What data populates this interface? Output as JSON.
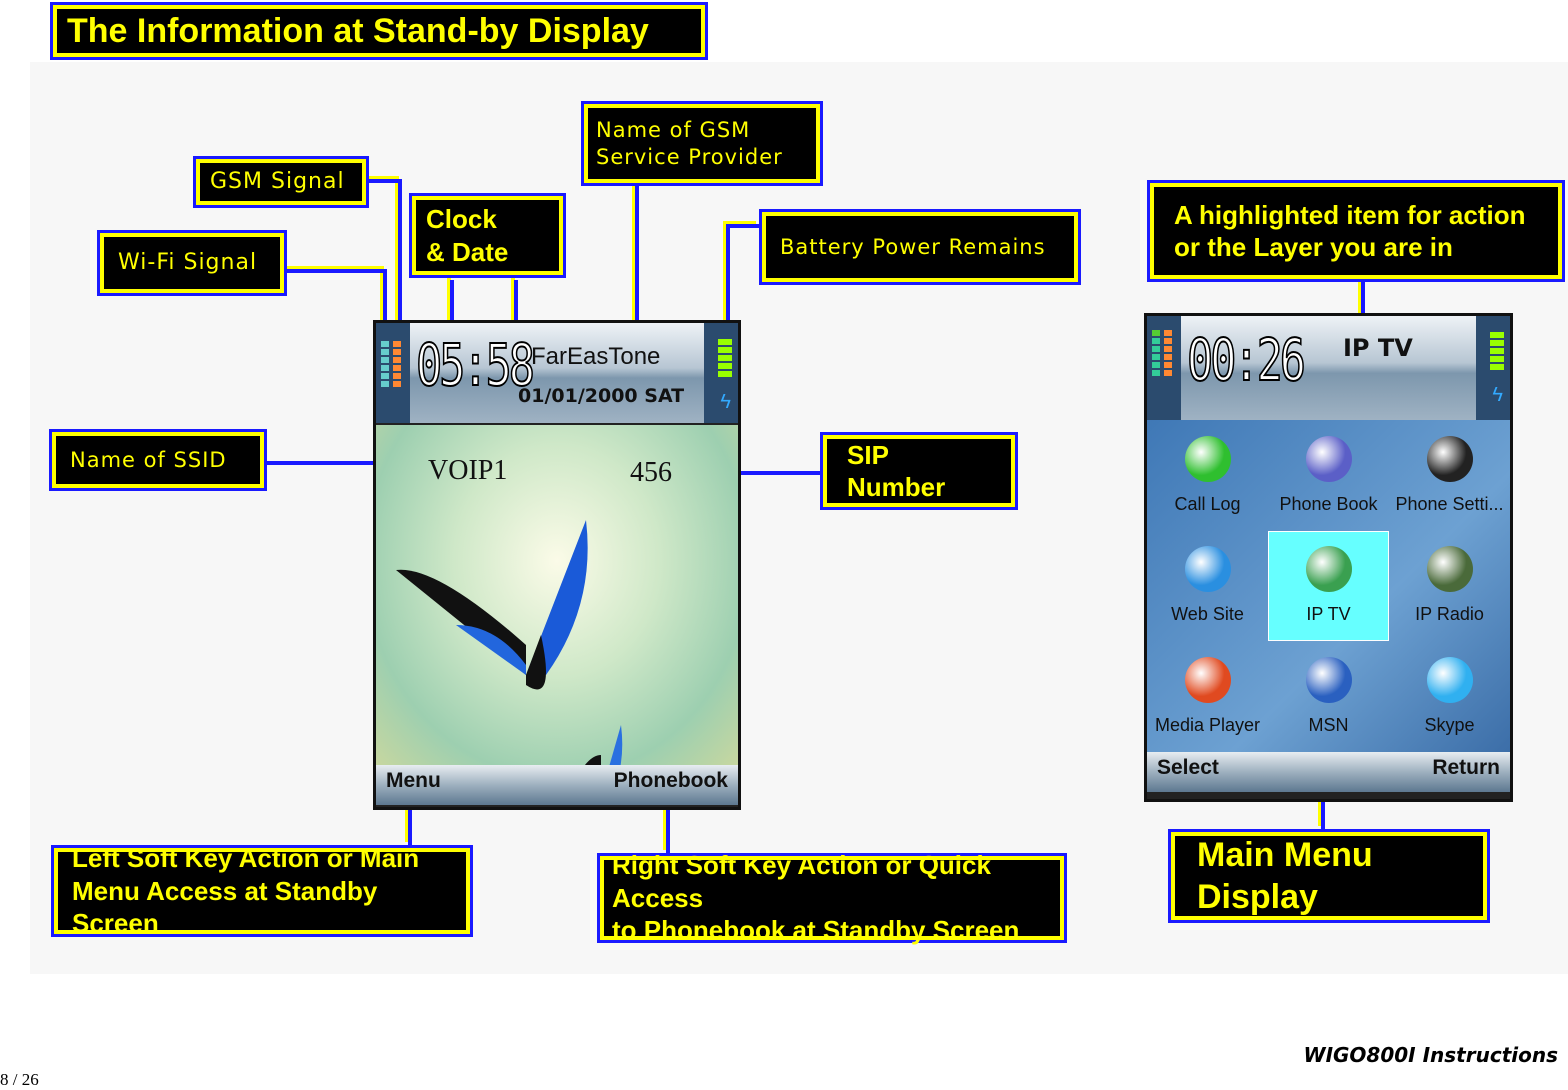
{
  "title": "The Information at Stand-by Display",
  "callouts": {
    "gsm_signal": "GSM Signal",
    "wifi_signal": "Wi-Fi Signal",
    "clock_date": "Clock\n        & Date",
    "gsm_provider": "Name of GSM\n Service Provider",
    "battery": "Battery Power Remains",
    "ssid": "Name of SSID",
    "sip": "SIP Number",
    "left_soft": "Left Soft Key Action or Main\nMenu Access at Standby Screen",
    "right_soft": "Right Soft Key Action or Quick Access\nto Phonebook at Standby Screen",
    "highlight": "A highlighted item for action\n               or the Layer you are in",
    "main_menu": "Main Menu Display"
  },
  "standby": {
    "time": "05:58",
    "provider": "FarEasTone",
    "date": "01/01/2000 SAT",
    "ssid": "VOIP1",
    "sip_number": "456",
    "left_key": "Menu",
    "right_key": "Phonebook"
  },
  "menu": {
    "time": "00:26",
    "title": "IP TV",
    "left_key": "Select",
    "right_key": "Return",
    "items": [
      {
        "label": "Call Log",
        "icon": "call-log-icon",
        "color": "#2fbf2f"
      },
      {
        "label": "Phone Book",
        "icon": "phone-book-icon",
        "color": "#5b5fc7"
      },
      {
        "label": "Phone Setti...",
        "icon": "phone-settings-icon",
        "color": "#222222"
      },
      {
        "label": "Web Site",
        "icon": "web-browser-icon",
        "color": "#2a8fe0"
      },
      {
        "label": "IP TV",
        "icon": "ip-tv-icon",
        "color": "#3aa050",
        "selected": true
      },
      {
        "label": "IP Radio",
        "icon": "ip-radio-icon",
        "color": "#4a6a3a"
      },
      {
        "label": "Media Player",
        "icon": "media-player-icon",
        "color": "#e04a20"
      },
      {
        "label": "MSN",
        "icon": "msn-icon",
        "color": "#2a60c0"
      },
      {
        "label": "Skype",
        "icon": "skype-icon",
        "color": "#30b0f0"
      }
    ]
  },
  "footer": {
    "doc_title": "WIGO800I Instructions",
    "page": "8 / 26"
  },
  "colors": {
    "label_bg": "#000000",
    "label_text": "#ffff00",
    "label_border": "#1a1aff",
    "highlight": "#66ffff"
  }
}
